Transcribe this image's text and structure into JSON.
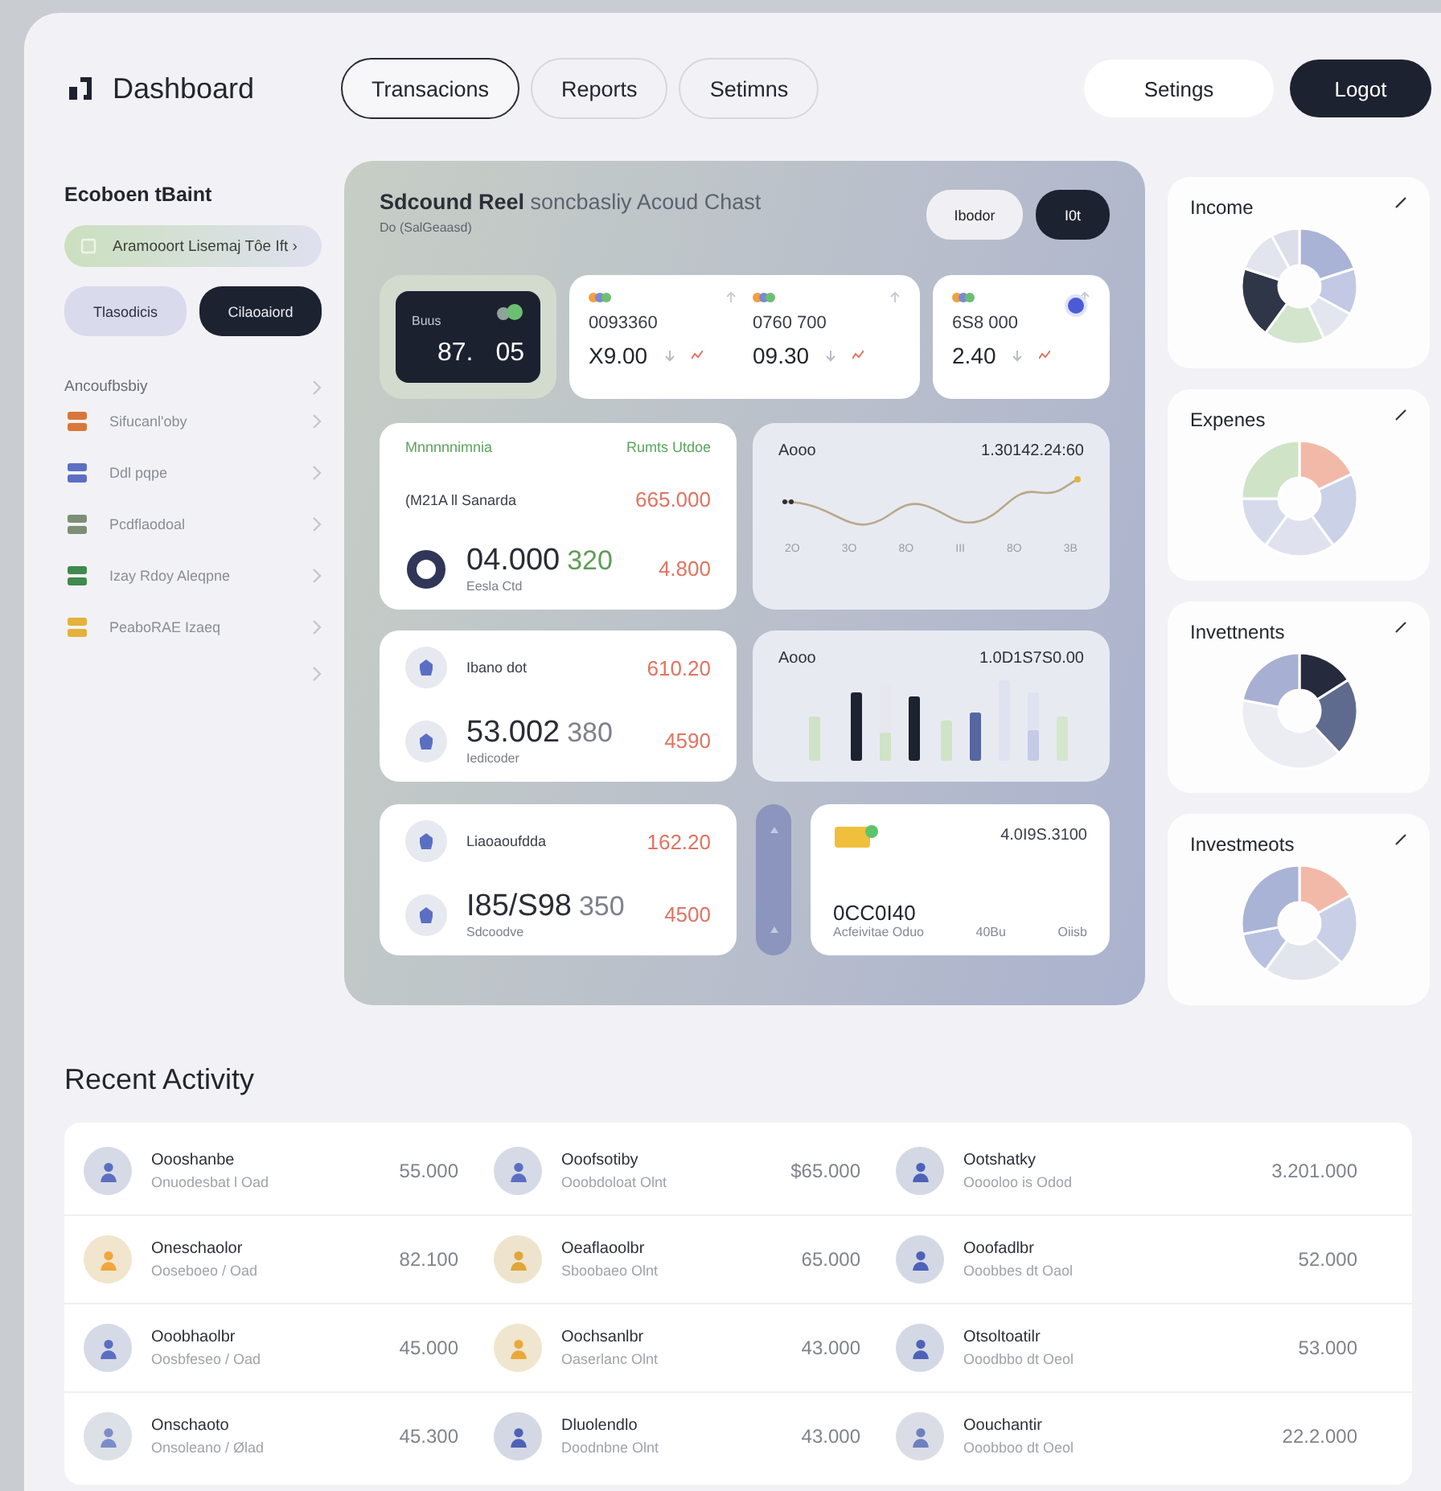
{
  "header": {
    "title": "Dashboard",
    "nav": [
      {
        "label": "Transacions",
        "selected": true
      },
      {
        "label": "Reports",
        "selected": false
      },
      {
        "label": "Setimns",
        "selected": false
      }
    ],
    "actions": [
      {
        "label": "Setings",
        "kind": "light"
      },
      {
        "label": "Logot",
        "kind": "dark"
      }
    ]
  },
  "sidebar": {
    "heading": "Ecoboen tBaint",
    "promo": "Aramooort Lisemaj Tôe Ift ›",
    "buttons": [
      {
        "label": "Tlasodicis",
        "kind": "light"
      },
      {
        "label": "Cilaoaiord",
        "kind": "dark"
      }
    ],
    "section": "Ancoufbsbiy",
    "items": [
      {
        "label": "Sifucanl'oby",
        "color": "#d9773a"
      },
      {
        "label": "Ddl pqpe",
        "color": "#5b6fc2"
      },
      {
        "label": "Pcdflaodoal",
        "color": "#7d8f74"
      },
      {
        "label": "Izay Rdoy Aleqpne",
        "color": "#3f8a4c"
      },
      {
        "label": "PeaboRAE Izaeq",
        "color": "#e3b13c"
      }
    ],
    "more_chevron": true
  },
  "overview": {
    "title": "Sdcound Reel",
    "title_faded": "soncbasliy Acoud Chast",
    "subtitle": "Do (SalGeaasd)",
    "buttons": [
      {
        "label": "Ibodor",
        "kind": "light"
      },
      {
        "label": "I0t",
        "kind": "dark"
      }
    ],
    "balance": {
      "label": "Buus",
      "value_a": "87.",
      "value_b": "05"
    },
    "ticker_cards": [
      {
        "dot": false,
        "items": [
          {
            "code": "0093360",
            "value": "X9.00"
          },
          {
            "code": "0760 700",
            "value": "09.30"
          }
        ]
      },
      {
        "dot": true,
        "items": [
          {
            "code": "6S8 000",
            "value": "2.40"
          }
        ]
      }
    ],
    "stat_cards": [
      {
        "kind": "ring",
        "label_left": "Mnnnnnimnia",
        "label_right": "Rumts Utdoe",
        "caption": "(M21A  ll Sanarda",
        "top_amount": "665.000",
        "big": "04.000",
        "faded": "320",
        "sub": "Eesla Ctd",
        "bottom_amount": "4.800"
      },
      {
        "kind": "avatars",
        "caption": "Ibano dot",
        "top_amount": "610.20",
        "big": "53.002",
        "faded": "380",
        "sub": "Iedicoder",
        "bottom_amount": "4590"
      },
      {
        "kind": "avatars",
        "caption": "Liaoaoufdda",
        "top_amount": "162.20",
        "big": "I85/S98",
        "faded": "350",
        "sub": "Sdcoodve",
        "bottom_amount": "4500"
      }
    ],
    "line_card": {
      "label": "Aooo",
      "value": "1.30142.24:60",
      "x_labels": [
        "2O",
        "3O",
        "8O",
        "III",
        "8O",
        "3B"
      ]
    },
    "bar_card": {
      "label": "Aooo",
      "value": "1.0D1S7S0.00"
    },
    "wallet_card": {
      "value": "4.0I9S.3100",
      "big": "0CC0I40",
      "foot": [
        "Acfeivitae Oduo",
        "40Bu",
        "Oiisb"
      ]
    }
  },
  "summary_cards": [
    {
      "title": "Income"
    },
    {
      "title": "Expenes"
    },
    {
      "title": "Invettnents"
    },
    {
      "title": "Investmeots"
    }
  ],
  "recent_activity": {
    "title": "Recent Activity",
    "rows": [
      [
        {
          "name": "Oooshanbe",
          "sub": "Onuodesbat l Oad",
          "amount": "55.000",
          "color": "#5b6fc2"
        },
        {
          "name": "Ooofsotiby",
          "sub": "Ooobdoloat Olnt",
          "amount": "$65.000",
          "color": "#5b6fc2"
        },
        {
          "name": "Ootshatky",
          "sub": "Ooooloo is Odod",
          "amount": "3.201.000",
          "color": "#4d62b8"
        }
      ],
      [
        {
          "name": "Oneschaolor",
          "sub": "Ooseboeo / Oad",
          "amount": "82.100",
          "color": "#f0a73c"
        },
        {
          "name": "Oeaflaoolbr",
          "sub": "Sboobaeo Olnt",
          "amount": "65.000",
          "color": "#e0a63a"
        },
        {
          "name": "Ooofadlbr",
          "sub": "Ooobbes dt Oaol",
          "amount": "52.000",
          "color": "#4d62b8"
        }
      ],
      [
        {
          "name": "Ooobhaolbr",
          "sub": "Oosbfeseo / Oad",
          "amount": "45.000",
          "color": "#5b6fc2"
        },
        {
          "name": "Oochsanlbr",
          "sub": "Oaserlanc Olnt",
          "amount": "43.000",
          "color": "#e9a93a"
        },
        {
          "name": "Otsoltoatilr",
          "sub": "Ooodbbo dt Oeol",
          "amount": "53.000",
          "color": "#4d62b8"
        }
      ],
      [
        {
          "name": "Onschaoto",
          "sub": "Onsoleano / Ølad",
          "amount": "45.300",
          "color": "#7b8cc8"
        },
        {
          "name": "Dluolendlo",
          "sub": "Doodnbne Olnt",
          "amount": "43.000",
          "color": "#4d62b8"
        },
        {
          "name": "Oouchantir",
          "sub": "Ooobboo dt Oeol",
          "amount": "22.2.000",
          "color": "#6f80c0"
        }
      ]
    ]
  }
}
